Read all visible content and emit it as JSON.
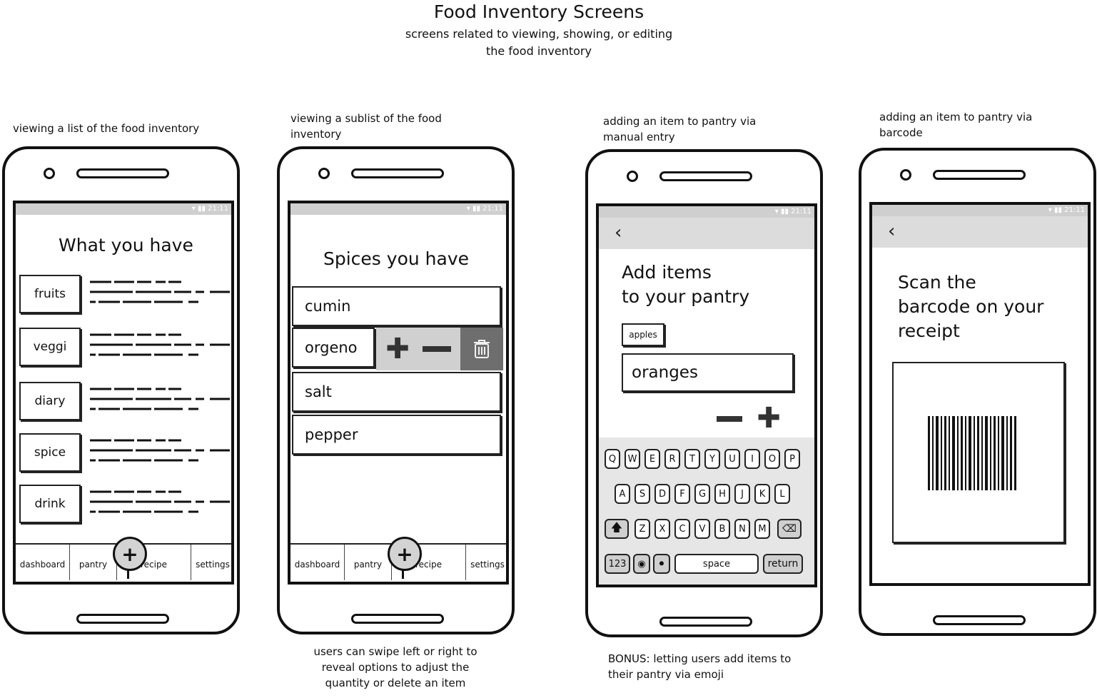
{
  "header": {
    "title": "Food Inventory Screens",
    "subtitle": "screens related to viewing, showing, or editing the food inventory"
  },
  "notes": {
    "screen1": "viewing a list of the food inventory",
    "screen2": "viewing a sublist of the food inventory",
    "screen3": "adding an item to pantry via manual entry",
    "screen4": "adding an item to pantry via barcode",
    "bottom2": "users can swipe left or right to reveal options to adjust the quantity or delete an item",
    "bottom3": "BONUS: letting users add items to their pantry via emoji"
  },
  "status_time": "21:11",
  "screen1": {
    "title": "What you have",
    "categories": [
      "fruits",
      "veggi",
      "diary",
      "spice",
      "drink"
    ]
  },
  "screen2": {
    "title": "Spices you have",
    "items": [
      "cumin",
      "orgeno",
      "salt",
      "pepper"
    ]
  },
  "tabs": {
    "dashboard": "dashboard",
    "pantry": "pantry",
    "recipe": "recipe",
    "settings": "settings",
    "add": "+"
  },
  "screen3": {
    "title_line1": "Add items",
    "title_line2": "to your pantry",
    "chip": "apples",
    "input_value": "oranges",
    "keyboard": {
      "row1": [
        "Q",
        "W",
        "E",
        "R",
        "T",
        "Y",
        "U",
        "I",
        "O",
        "P"
      ],
      "row2": [
        "A",
        "S",
        "D",
        "F",
        "G",
        "H",
        "J",
        "K",
        "L"
      ],
      "row3": [
        "Z",
        "X",
        "C",
        "V",
        "B",
        "N",
        "M"
      ],
      "numbers": "123",
      "space": "space",
      "return": "return"
    }
  },
  "screen4": {
    "title_line1": "Scan the",
    "title_line2": "barcode on your",
    "title_line3": "receipt"
  },
  "colors": {
    "statusbar": "#cfcfcf",
    "appbar": "#dcdcdc",
    "swipe_actions": "#d0d0d0",
    "delete_action": "#6e6e6e",
    "fab": "#d3d3d3"
  }
}
